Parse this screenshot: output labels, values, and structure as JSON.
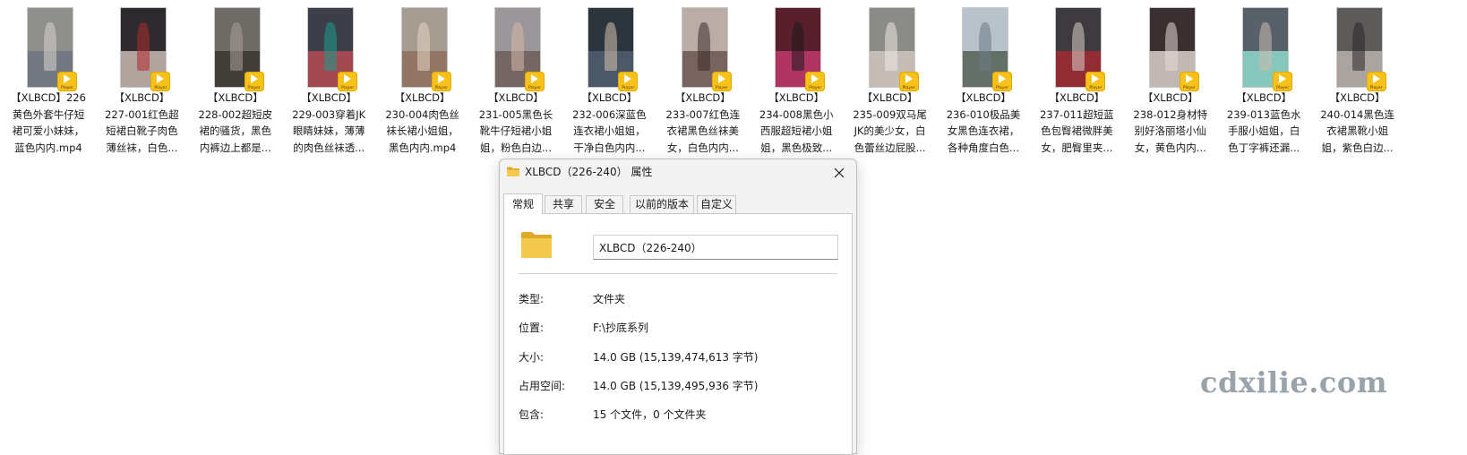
{
  "files": [
    {
      "lines": [
        "【XLBCD】226",
        "黄色外套牛仔短",
        "裙可爱小妹妹，",
        "蓝色内内.mp4"
      ],
      "thumb": {
        "bg": "#8f8f8c",
        "lo": "#6e7380",
        "fig": "#d9d4cc"
      }
    },
    {
      "lines": [
        "【XLBCD】",
        "227-001红色超",
        "短裙白靴子肉色",
        "薄丝袜，白色..."
      ],
      "thumb": {
        "bg": "#2c2a2d",
        "lo": "#c9b9b1",
        "fig": "#b02c30"
      }
    },
    {
      "lines": [
        "【XLBCD】",
        "228-002超短皮",
        "裙的骚货，黑色",
        "内裤边上都是..."
      ],
      "thumb": {
        "bg": "#6f6c68",
        "lo": "#3a3733",
        "fig": "#aaa095"
      }
    },
    {
      "lines": [
        "【XLBCD】",
        "229-003穿着JK",
        "眼睛妹妹，薄薄",
        "的肉色丝袜透..."
      ],
      "thumb": {
        "bg": "#3c3f4a",
        "lo": "#b44a52",
        "fig": "#1a9c8c"
      }
    },
    {
      "lines": [
        "【XLBCD】",
        "230-004肉色丝",
        "袜长裙小姐姐，",
        "黑色内内.mp4"
      ],
      "thumb": {
        "bg": "#a79c91",
        "lo": "#8e6f5d",
        "fig": "#e4d3c2"
      }
    },
    {
      "lines": [
        "【XLBCD】",
        "231-005黑色长",
        "靴牛仔短裙小姐",
        "姐，粉色白边..."
      ],
      "thumb": {
        "bg": "#9a9699",
        "lo": "#6d5e58",
        "fig": "#d6b8a7"
      }
    },
    {
      "lines": [
        "【XLBCD】",
        "232-006深蓝色",
        "连衣裙小姐姐，",
        "干净白色内内..."
      ],
      "thumb": {
        "bg": "#2c343c",
        "lo": "#505f6e",
        "fig": "#d7c1ae"
      }
    },
    {
      "lines": [
        "【XLBCD】",
        "233-007红色连",
        "衣裙黑色丝袜美",
        "女，白色内内..."
      ],
      "thumb": {
        "bg": "#b9ada6",
        "lo": "#6b5751",
        "fig": "#3c2c2a"
      }
    },
    {
      "lines": [
        "【XLBCD】",
        "234-008黑色小",
        "西服超短裙小姐",
        "姐，黑色极致..."
      ],
      "thumb": {
        "bg": "#5a1f2c",
        "lo": "#c13a6c",
        "fig": "#1c1a1d"
      }
    },
    {
      "lines": [
        "【XLBCD】",
        "235-009双马尾",
        "JK的美少女，白",
        "色蕾丝边屁股..."
      ],
      "thumb": {
        "bg": "#8b8b87",
        "lo": "#cfc4bd",
        "fig": "#efe9e3"
      }
    },
    {
      "lines": [
        "【XLBCD】",
        "236-010极品美",
        "女黑色连衣裙，",
        "各种角度白色..."
      ],
      "thumb": {
        "bg": "#b8c2cb",
        "lo": "#556057",
        "fig": "#6b7a84"
      }
    },
    {
      "lines": [
        "【XLBCD】",
        "237-011超短蓝",
        "色包臀裙微胖美",
        "女，肥臀里夹..."
      ],
      "thumb": {
        "bg": "#3d3b3f",
        "lo": "#a12b34",
        "fig": "#d7cfc9"
      }
    },
    {
      "lines": [
        "【XLBCD】",
        "238-012身材特",
        "别好洛丽塔小仙",
        "女，黄色内内..."
      ],
      "thumb": {
        "bg": "#3a3032",
        "lo": "#d9d0cb",
        "fig": "#e3d8d5"
      }
    },
    {
      "lines": [
        "【XLBCD】",
        "239-013蓝色水",
        "手服小姐姐，白",
        "色丁字裤还漏..."
      ],
      "thumb": {
        "bg": "#58616a",
        "lo": "#8fd9c9",
        "fig": "#c9bcb0"
      }
    },
    {
      "lines": [
        "【XLBCD】",
        "240-014黑色连",
        "衣裙黑靴小姐",
        "姐，紫色白边..."
      ],
      "thumb": {
        "bg": "#5d5a5a",
        "lo": "#b7b1ad",
        "fig": "#2a2628"
      }
    }
  ],
  "player_badge": {
    "label": "Player",
    "color": "#f6c21a"
  },
  "dialog": {
    "title": "XLBCD（226-240） 属性",
    "tabs": [
      {
        "label": "常规",
        "active": true
      },
      {
        "label": "共享",
        "active": false
      },
      {
        "label": "安全",
        "active": false
      },
      {
        "label": "以前的版本",
        "active": false
      },
      {
        "label": "自定义",
        "active": false
      }
    ],
    "folder_name_value": "XLBCD（226-240）",
    "properties": [
      {
        "label": "类型:",
        "value": "文件夹"
      },
      {
        "label": "位置:",
        "value": "F:\\抄底系列"
      },
      {
        "label": "大小:",
        "value": "14.0 GB (15,139,474,613 字节)"
      },
      {
        "label": "占用空间:",
        "value": "14.0 GB (15,139,495,936 字节)"
      },
      {
        "label": "包含:",
        "value": "15 个文件，0 个文件夹"
      }
    ]
  },
  "watermark": "cdxilie.com",
  "colors": {
    "folder": "#f2c94c",
    "folder_dark": "#e0a92a",
    "dialog_bg": "#f3f3f3"
  }
}
